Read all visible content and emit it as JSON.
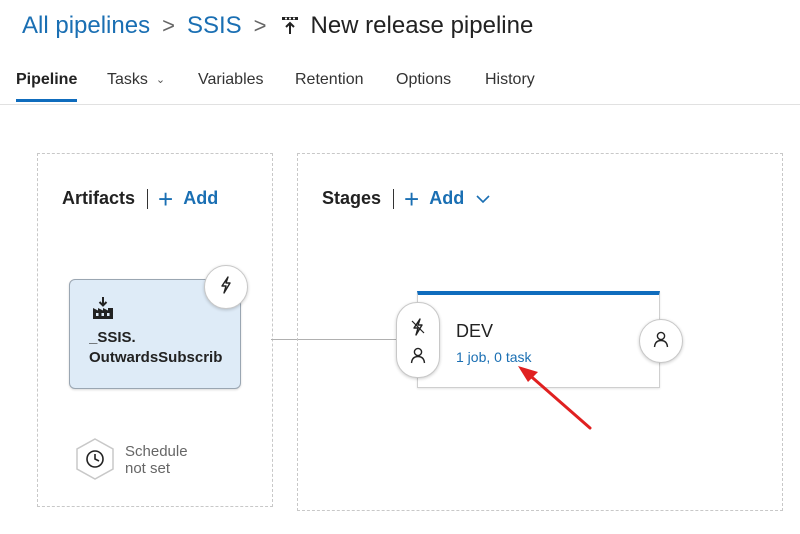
{
  "breadcrumb": {
    "items": [
      "All pipelines",
      "SSIS"
    ],
    "separator": ">",
    "current": "New release pipeline"
  },
  "tabs": [
    {
      "label": "Pipeline",
      "active": true
    },
    {
      "label": "Tasks",
      "has_dropdown": true
    },
    {
      "label": "Variables"
    },
    {
      "label": "Retention"
    },
    {
      "label": "Options"
    },
    {
      "label": "History"
    }
  ],
  "artifacts_panel": {
    "title": "Artifacts",
    "add_label": "Add",
    "artifact": {
      "name_line1": "_SSIS.",
      "name_line2": "OutwardsSubscrib",
      "icon": "build-icon"
    },
    "trigger_icon": "lightning-icon",
    "schedule": {
      "line1": "Schedule",
      "line2": "not set",
      "icon": "clock-icon"
    }
  },
  "stages_panel": {
    "title": "Stages",
    "add_label": "Add",
    "stage": {
      "name": "DEV",
      "tasks_link": "1 job, 0 task"
    },
    "pre_deployment_icons": [
      "lightning-icon",
      "person-icon"
    ],
    "post_deployment_icon": "person-icon"
  },
  "colors": {
    "accent": "#0f6cbd",
    "link": "#1a6fb3",
    "artifact_bg": "#deebf7",
    "annotation_arrow": "#e02020"
  }
}
